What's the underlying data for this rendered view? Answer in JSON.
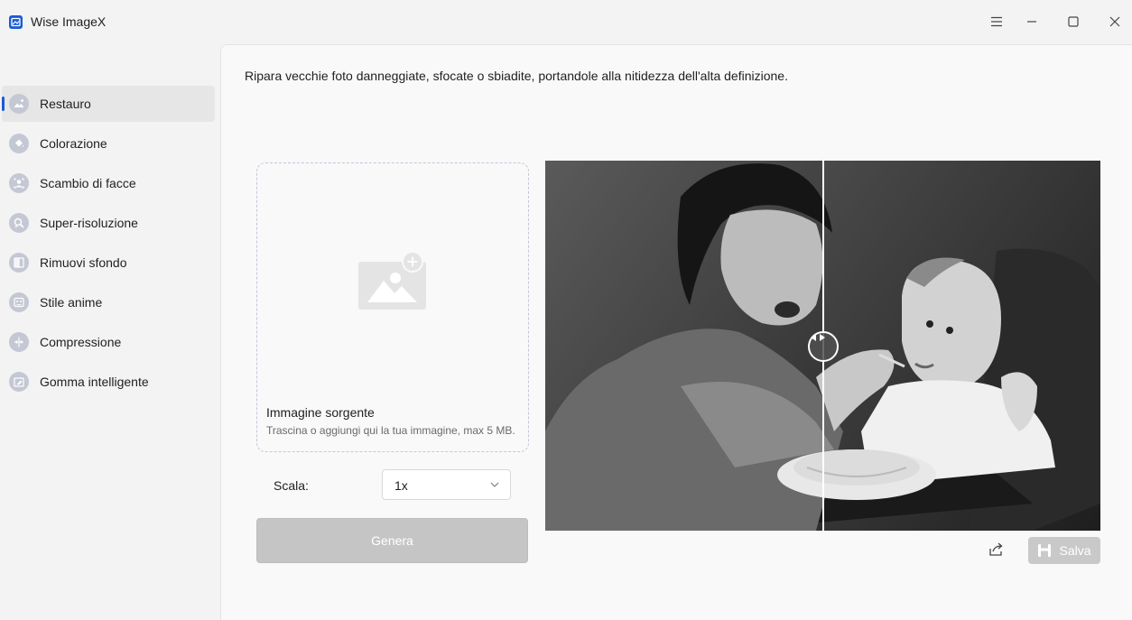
{
  "window": {
    "title": "Wise ImageX"
  },
  "sidebar": {
    "items": [
      {
        "label": "Restauro",
        "icon": "restore-icon",
        "active": true
      },
      {
        "label": "Colorazione",
        "icon": "colorize-icon",
        "active": false
      },
      {
        "label": "Scambio di facce",
        "icon": "face-swap-icon",
        "active": false
      },
      {
        "label": "Super-risoluzione",
        "icon": "super-resolution-icon",
        "active": false
      },
      {
        "label": "Rimuovi sfondo",
        "icon": "remove-background-icon",
        "active": false
      },
      {
        "label": "Stile anime",
        "icon": "anime-style-icon",
        "active": false
      },
      {
        "label": "Compressione",
        "icon": "compress-icon",
        "active": false
      },
      {
        "label": "Gomma intelligente",
        "icon": "smart-eraser-icon",
        "active": false
      }
    ]
  },
  "main": {
    "description": "Ripara vecchie foto danneggiate, sfocate o sbiadite, portandole alla nitidezza dell'alta definizione.",
    "dropzone": {
      "title": "Immagine sorgente",
      "hint": "Trascina o aggiungi qui la tua immagine, max 5 MB."
    },
    "scale": {
      "label": "Scala:",
      "value": "1x"
    },
    "generate_label": "Genera",
    "save_label": "Salva"
  },
  "colors": {
    "accent": "#1a5bd6",
    "disabled_button": "#c5c5c5",
    "sidebar_active": "#e6e6e6"
  }
}
